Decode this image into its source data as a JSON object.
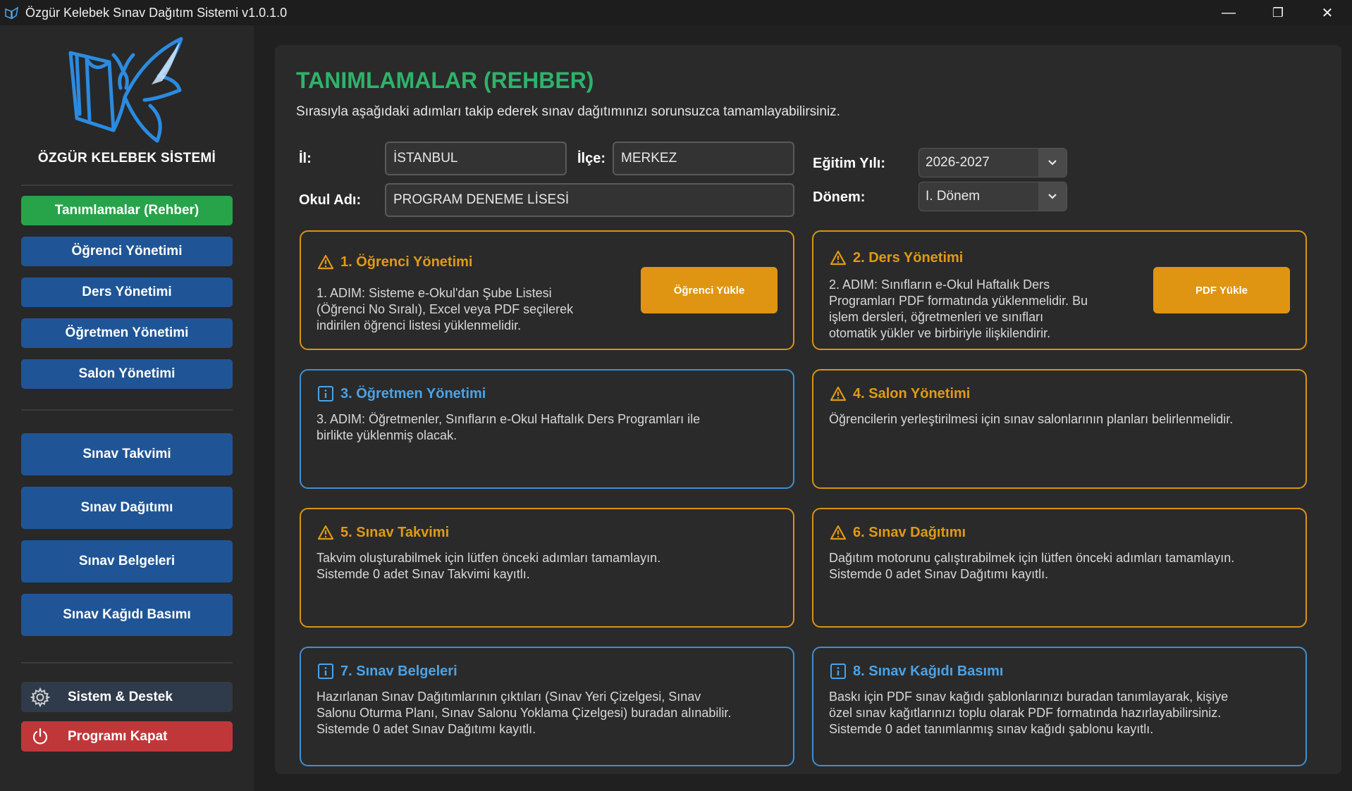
{
  "window": {
    "title": "Özgür Kelebek Sınav Dağıtım Sistemi v1.0.1.0",
    "minimize": "—",
    "maximize": "❐",
    "close": "✕"
  },
  "sidebar": {
    "brand": "ÖZGÜR KELEBEK SİSTEMİ",
    "nav_top": [
      {
        "label": "Tanımlamalar (Rehber)",
        "active": true
      },
      {
        "label": "Öğrenci Yönetimi"
      },
      {
        "label": "Ders Yönetimi"
      },
      {
        "label": "Öğretmen Yönetimi"
      },
      {
        "label": "Salon Yönetimi"
      }
    ],
    "nav_exam": [
      {
        "label": "Sınav Takvimi"
      },
      {
        "label": "Sınav Dağıtımı"
      },
      {
        "label": "Sınav Belgeleri"
      },
      {
        "label": "Sınav Kağıdı Basımı"
      }
    ],
    "system_label": "Sistem & Destek",
    "exit_label": "Programı Kapat"
  },
  "main": {
    "title": "TANIMLAMALAR (REHBER)",
    "subtitle": "Sırasıyla aşağıdaki adımları takip ederek sınav dağıtımınızı sorunsuzca tamamlayabilirsiniz.",
    "form": {
      "il_label": "İl:",
      "il_value": "İSTANBUL",
      "ilce_label": "İlçe:",
      "ilce_value": "MERKEZ",
      "okul_label": "Okul Adı:",
      "okul_value": "PROGRAM DENEME LİSESİ",
      "egitim_label": "Eğitim Yılı:",
      "egitim_value": "2026-2027",
      "donem_label": "Dönem:",
      "donem_value": "I. Dönem"
    },
    "cards": [
      {
        "title": "1. Öğrenci Yönetimi",
        "status": "warning",
        "lines": [
          "1. ADIM: Sisteme e-Okul'dan Şube Listesi",
          "(Öğrenci No Sıralı), Excel veya PDF seçilerek",
          "indirilen öğrenci listesi yüklenmelidir."
        ],
        "button": "Öğrenci Yükle"
      },
      {
        "title": "2. Ders Yönetimi",
        "status": "warning",
        "lines": [
          "2. ADIM: Sınıfların e-Okul Haftalık Ders",
          "Programları PDF formatında yüklenmelidir. Bu",
          "işlem dersleri, öğretmenleri ve sınıfları",
          "otomatik yükler ve birbiriyle ilişkilendirir."
        ],
        "button": "PDF Yükle"
      },
      {
        "title": "3. Öğretmen Yönetimi",
        "status": "info",
        "lines": [
          "3. ADIM: Öğretmenler, Sınıfların e-Okul Haftalık Ders Programları ile",
          "birlikte yüklenmiş olacak."
        ]
      },
      {
        "title": "4. Salon Yönetimi",
        "status": "warning",
        "lines": [
          "Öğrencilerin yerleştirilmesi için sınav salonlarının planları belirlenmelidir."
        ]
      },
      {
        "title": "5. Sınav Takvimi",
        "status": "warning",
        "lines": [
          "Takvim oluşturabilmek için lütfen önceki adımları tamamlayın.",
          "Sistemde 0 adet Sınav Takvimi kayıtlı."
        ]
      },
      {
        "title": "6. Sınav Dağıtımı",
        "status": "warning",
        "lines": [
          "Dağıtım motorunu çalıştırabilmek için lütfen önceki adımları tamamlayın.",
          "Sistemde 0 adet Sınav Dağıtımı kayıtlı."
        ]
      },
      {
        "title": "7. Sınav Belgeleri",
        "status": "info",
        "lines": [
          "Hazırlanan Sınav Dağıtımlarının çıktıları (Sınav Yeri Çizelgesi, Sınav",
          "Salonu Oturma Planı, Sınav Salonu Yoklama Çizelgesi) buradan alınabilir.",
          "Sistemde 0 adet Sınav Dağıtımı kayıtlı."
        ]
      },
      {
        "title": "8. Sınav Kağıdı Basımı",
        "status": "info",
        "lines": [
          "Baskı için PDF sınav kağıdı şablonlarınızı buradan tanımlayarak, kişiye",
          "özel sınav kağıtlarınızı toplu olarak PDF formatında hazırlayabilirsiniz.",
          "Sistemde 0 adet tanımlanmış sınav kağıdı şablonu kayıtlı."
        ]
      }
    ]
  },
  "icons": {
    "app": "butterfly-book-icon",
    "warning": "warning-triangle-icon",
    "info": "info-box-icon",
    "system": "gear-icon",
    "exit": "power-icon"
  },
  "colors": {
    "active_nav": "#27a34a",
    "nav": "#1f5596",
    "title": "#2eb36a",
    "warning": "#e09a16",
    "info": "#4aa3e8",
    "exit": "#c0373a"
  }
}
